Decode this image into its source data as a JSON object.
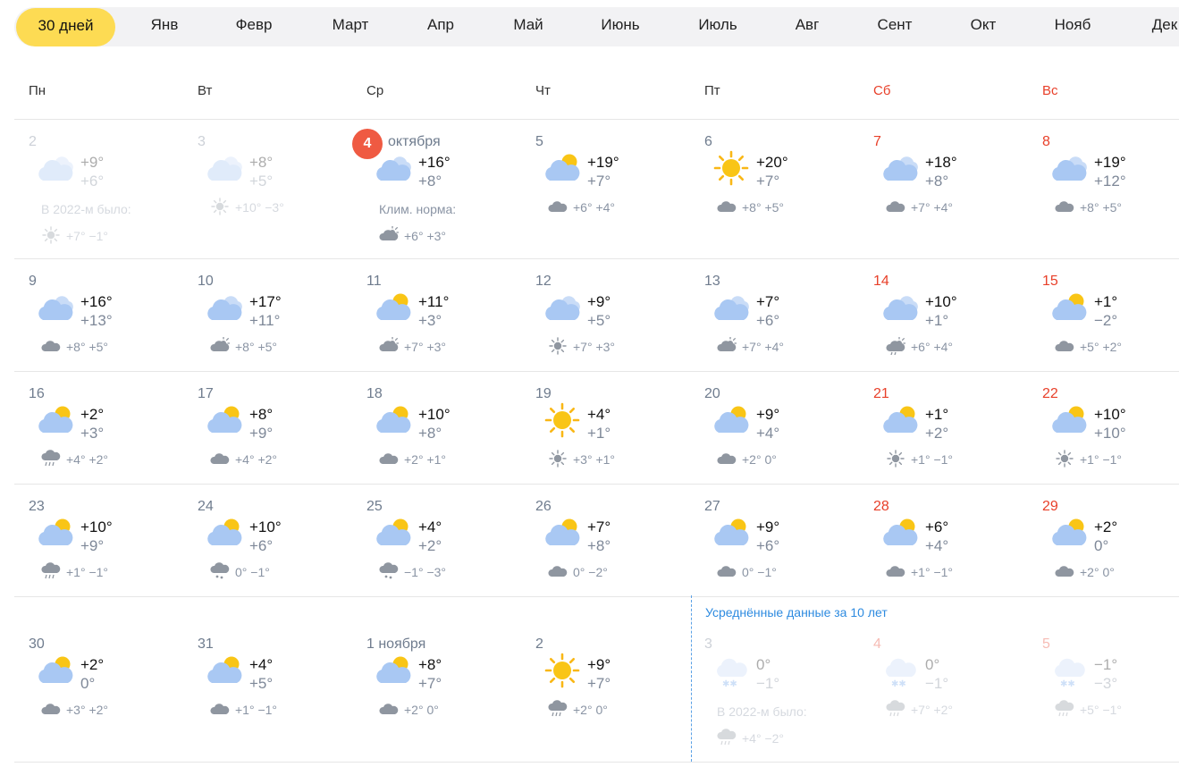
{
  "tabs": [
    "30 дней",
    "Янв",
    "Февр",
    "Март",
    "Апр",
    "Май",
    "Июнь",
    "Июль",
    "Авг",
    "Сент",
    "Окт",
    "Нояб",
    "Дек"
  ],
  "weekdays": [
    {
      "label": "Пн",
      "weekend": false
    },
    {
      "label": "Вт",
      "weekend": false
    },
    {
      "label": "Ср",
      "weekend": false
    },
    {
      "label": "Чт",
      "weekend": false
    },
    {
      "label": "Пт",
      "weekend": false
    },
    {
      "label": "Сб",
      "weekend": true
    },
    {
      "label": "Вс",
      "weekend": true
    }
  ],
  "avg_note": "Усреднённые данные за 10 лет",
  "colors": {
    "accent": "#fddb53",
    "weekend": "#e8402a",
    "today": "#ef5a42",
    "link": "#2e8be0"
  },
  "days": [
    {
      "d": "2",
      "icon": "cloudy",
      "day": "+9°",
      "night": "+6°",
      "faded": true,
      "note": "В 2022-м было:",
      "sub_icon": "sun",
      "sub": "+7° −1°"
    },
    {
      "d": "3",
      "icon": "cloudy",
      "day": "+8°",
      "night": "+5°",
      "faded": true,
      "sub_icon": "sun",
      "sub": "+10° −3°"
    },
    {
      "d": "4",
      "today": true,
      "month": "октября",
      "icon": "cloudy",
      "day": "+16°",
      "night": "+8°",
      "note": "Клим. норма:",
      "sub_icon": "partly",
      "sub": "+6° +3°"
    },
    {
      "d": "5",
      "icon": "partly",
      "day": "+19°",
      "night": "+7°",
      "sub_icon": "cloud",
      "sub": "+6° +4°"
    },
    {
      "d": "6",
      "icon": "sun",
      "day": "+20°",
      "night": "+7°",
      "sub_icon": "cloud",
      "sub": "+8° +5°"
    },
    {
      "d": "7",
      "red": true,
      "icon": "cloudy",
      "day": "+18°",
      "night": "+8°",
      "sub_icon": "cloud",
      "sub": "+7° +4°"
    },
    {
      "d": "8",
      "red": true,
      "icon": "cloudy",
      "day": "+19°",
      "night": "+12°",
      "sub_icon": "cloud",
      "sub": "+8° +5°"
    },
    {
      "d": "9",
      "icon": "cloudy",
      "day": "+16°",
      "night": "+13°",
      "sub_icon": "cloud",
      "sub": "+8° +5°"
    },
    {
      "d": "10",
      "icon": "cloudy",
      "day": "+17°",
      "night": "+11°",
      "sub_icon": "partly",
      "sub": "+8° +5°"
    },
    {
      "d": "11",
      "icon": "partly",
      "day": "+11°",
      "night": "+3°",
      "sub_icon": "partly",
      "sub": "+7° +3°"
    },
    {
      "d": "12",
      "icon": "cloudy",
      "day": "+9°",
      "night": "+5°",
      "sub_icon": "sun",
      "sub": "+7° +3°"
    },
    {
      "d": "13",
      "icon": "cloudy",
      "day": "+7°",
      "night": "+6°",
      "sub_icon": "partly",
      "sub": "+7° +4°"
    },
    {
      "d": "14",
      "red": true,
      "icon": "cloudy",
      "day": "+10°",
      "night": "+1°",
      "sub_icon": "partly-rain",
      "sub": "+6° +4°"
    },
    {
      "d": "15",
      "red": true,
      "icon": "partly",
      "day": "+1°",
      "night": "−2°",
      "sub_icon": "cloud",
      "sub": "+5° +2°"
    },
    {
      "d": "16",
      "icon": "partly",
      "day": "+2°",
      "night": "+3°",
      "sub_icon": "rain",
      "sub": "+4° +2°"
    },
    {
      "d": "17",
      "icon": "partly",
      "day": "+8°",
      "night": "+9°",
      "sub_icon": "cloud",
      "sub": "+4° +2°"
    },
    {
      "d": "18",
      "icon": "partly",
      "day": "+10°",
      "night": "+8°",
      "sub_icon": "cloud",
      "sub": "+2° +1°"
    },
    {
      "d": "19",
      "icon": "sun",
      "day": "+4°",
      "night": "+1°",
      "sub_icon": "sun",
      "sub": "+3° +1°"
    },
    {
      "d": "20",
      "icon": "partly",
      "day": "+9°",
      "night": "+4°",
      "sub_icon": "cloud",
      "sub": "+2° 0°"
    },
    {
      "d": "21",
      "red": true,
      "icon": "partly",
      "day": "+1°",
      "night": "+2°",
      "sub_icon": "sun",
      "sub": "+1° −1°"
    },
    {
      "d": "22",
      "red": true,
      "icon": "partly",
      "day": "+10°",
      "night": "+10°",
      "sub_icon": "sun",
      "sub": "+1° −1°"
    },
    {
      "d": "23",
      "icon": "partly",
      "day": "+10°",
      "night": "+9°",
      "sub_icon": "rain",
      "sub": "+1° −1°"
    },
    {
      "d": "24",
      "icon": "partly",
      "day": "+10°",
      "night": "+6°",
      "sub_icon": "snow",
      "sub": "0° −1°"
    },
    {
      "d": "25",
      "icon": "partly",
      "day": "+4°",
      "night": "+2°",
      "sub_icon": "snow",
      "sub": "−1° −3°"
    },
    {
      "d": "26",
      "icon": "partly",
      "day": "+7°",
      "night": "+8°",
      "sub_icon": "cloud",
      "sub": "0° −2°"
    },
    {
      "d": "27",
      "icon": "partly",
      "day": "+9°",
      "night": "+6°",
      "sub_icon": "cloud",
      "sub": "0° −1°"
    },
    {
      "d": "28",
      "red": true,
      "icon": "partly",
      "day": "+6°",
      "night": "+4°",
      "sub_icon": "cloud",
      "sub": "+1° −1°"
    },
    {
      "d": "29",
      "red": true,
      "icon": "partly",
      "day": "+2°",
      "night": "0°",
      "sub_icon": "cloud",
      "sub": "+2° 0°"
    },
    {
      "d": "30",
      "icon": "partly",
      "day": "+2°",
      "night": "0°",
      "sub_icon": "cloud",
      "sub": "+3° +2°"
    },
    {
      "d": "31",
      "icon": "partly",
      "day": "+4°",
      "night": "+5°",
      "sub_icon": "cloud",
      "sub": "+1° −1°"
    },
    {
      "d": "1 ноября",
      "icon": "partly",
      "day": "+8°",
      "night": "+7°",
      "sub_icon": "cloud",
      "sub": "+2° 0°"
    },
    {
      "d": "2",
      "icon": "sun",
      "day": "+9°",
      "night": "+7°",
      "sub_icon": "rain",
      "sub": "+2° 0°"
    },
    {
      "d": "3",
      "icon": "snow-cloud",
      "day": "0°",
      "night": "−1°",
      "faded": true,
      "note": "В 2022-м было:",
      "sub_icon": "rain",
      "sub": "+4° −2°"
    },
    {
      "d": "4",
      "red": true,
      "icon": "snow-cloud",
      "day": "0°",
      "night": "−1°",
      "faded": true,
      "sub_icon": "rain",
      "sub": "+7° +2°"
    },
    {
      "d": "5",
      "red": true,
      "icon": "snow-cloud",
      "day": "−1°",
      "night": "−3°",
      "faded": true,
      "sub_icon": "rain",
      "sub": "+5° −1°"
    }
  ]
}
